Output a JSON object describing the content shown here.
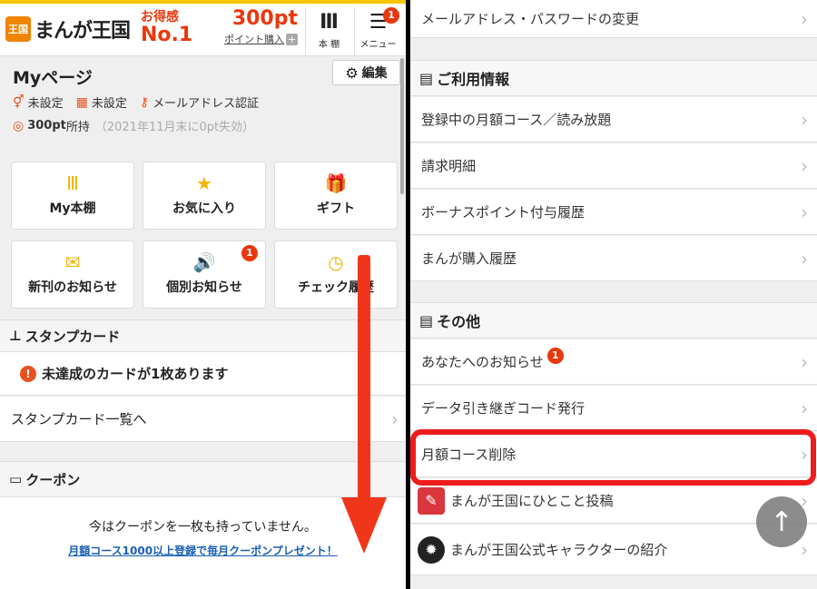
{
  "header": {
    "logo_mark": "王国",
    "logo_text": "まんが王国",
    "otoku_top": "お得感",
    "otoku_bottom": "No.1",
    "points": "300pt",
    "buy_points": "ポイント購入",
    "shelf_icon": "Ⅲ",
    "shelf_label": "本 棚",
    "menu_label": "メニュー",
    "menu_badge": "1"
  },
  "mypage": {
    "title": "Myページ",
    "edit_label": "編集",
    "gender": "未設定",
    "birthday": "未設定",
    "email_auth": "メールアドレス認証",
    "points": "300pt",
    "points_suffix": "所持",
    "points_note": "（2021年11月末に0pt失効）"
  },
  "tiles": [
    {
      "label": "My本棚",
      "icon": "Ⅲ"
    },
    {
      "label": "お気に入り",
      "icon": "★"
    },
    {
      "label": "ギフト",
      "icon": "🎁"
    },
    {
      "label": "新刊のお知らせ",
      "icon": "✉"
    },
    {
      "label": "個別お知らせ",
      "icon": "🔊",
      "badge": "1"
    },
    {
      "label": "チェック履歴",
      "icon": "◷"
    }
  ],
  "stamp": {
    "title": "スタンプカード",
    "notice": "未達成のカードが1枚あります",
    "list_link": "スタンプカード一覧へ"
  },
  "coupon": {
    "title": "クーポン",
    "empty_text": "今はクーポンを一枚も持っていません。",
    "promo_link": "月額コース1000以上登録で毎月クーポンプレゼント！"
  },
  "right": {
    "top_item": "メールアドレス・パスワードの変更",
    "usage_title": "ご利用情報",
    "usage_items": [
      "登録中の月額コース／読み放題",
      "請求明細",
      "ボーナスポイント付与履歴",
      "まんが購入履歴"
    ],
    "other_title": "その他",
    "other_items": [
      {
        "label": "あなたへのお知らせ",
        "badge": "1"
      },
      {
        "label": "データ引き継ぎコード発行"
      },
      {
        "label": "月額コース削除"
      },
      {
        "label": "まんが王国にひとこと投稿"
      },
      {
        "label": "まんが王国公式キャラクターの紹介"
      }
    ]
  },
  "colors": {
    "accent": "#e8380d",
    "highlight": "#ee1c1c",
    "arrow": "#f0361a",
    "brand_yellow": "#f6c400"
  }
}
